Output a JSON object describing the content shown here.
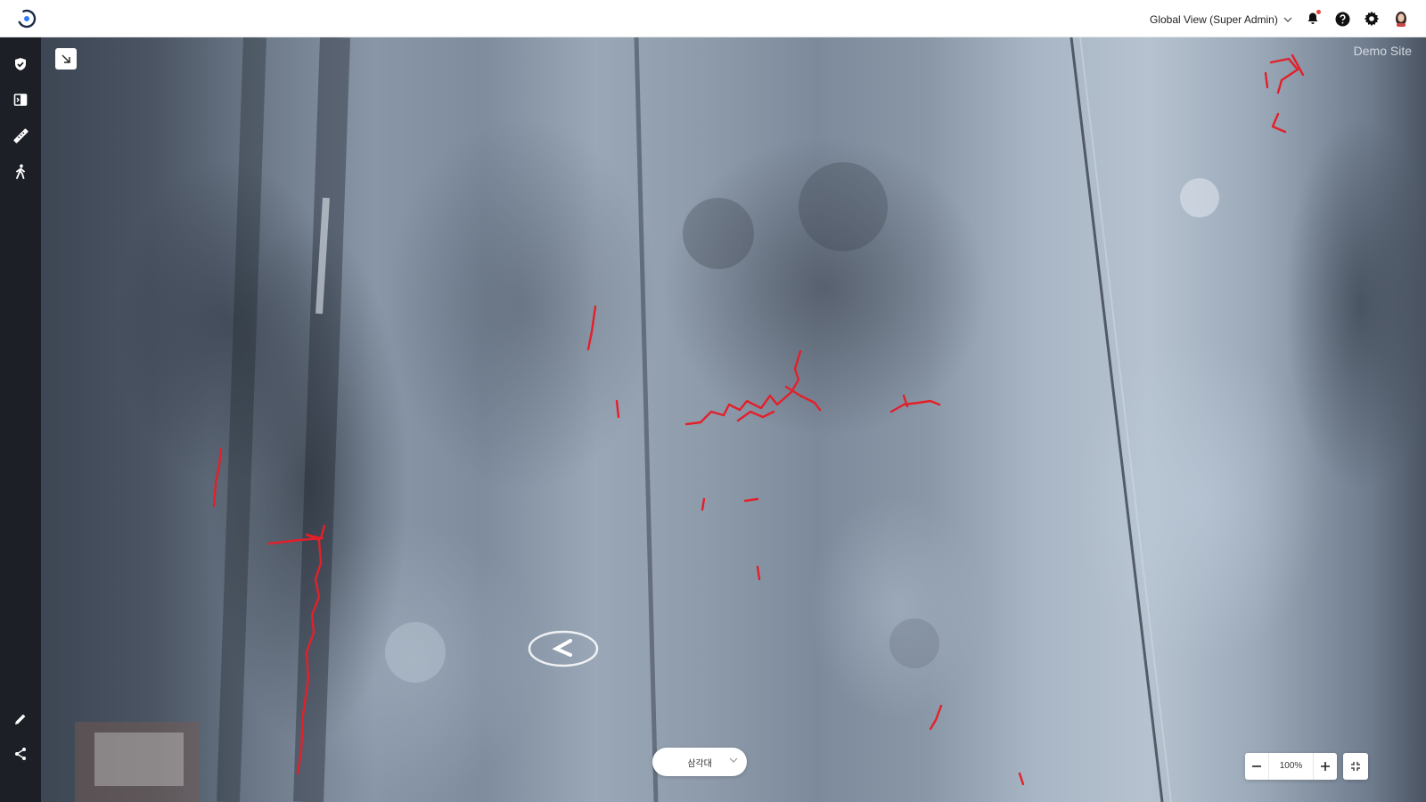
{
  "header": {
    "view_selector": "Global View (Super Admin)",
    "icons": [
      "logo-icon",
      "bell-icon",
      "help-icon",
      "gear-icon",
      "user-avatar-icon"
    ]
  },
  "sidebar": {
    "tools": [
      "shield-check-icon",
      "compare-icon",
      "ruler-icon",
      "walk-icon",
      "pencil-icon",
      "share-icon"
    ]
  },
  "viewer": {
    "site_label": "Demo Site",
    "layer_selector": "삼각대",
    "zoom_level": "100%",
    "overlay": "crack detection",
    "overlay_color": "#e3202a"
  }
}
